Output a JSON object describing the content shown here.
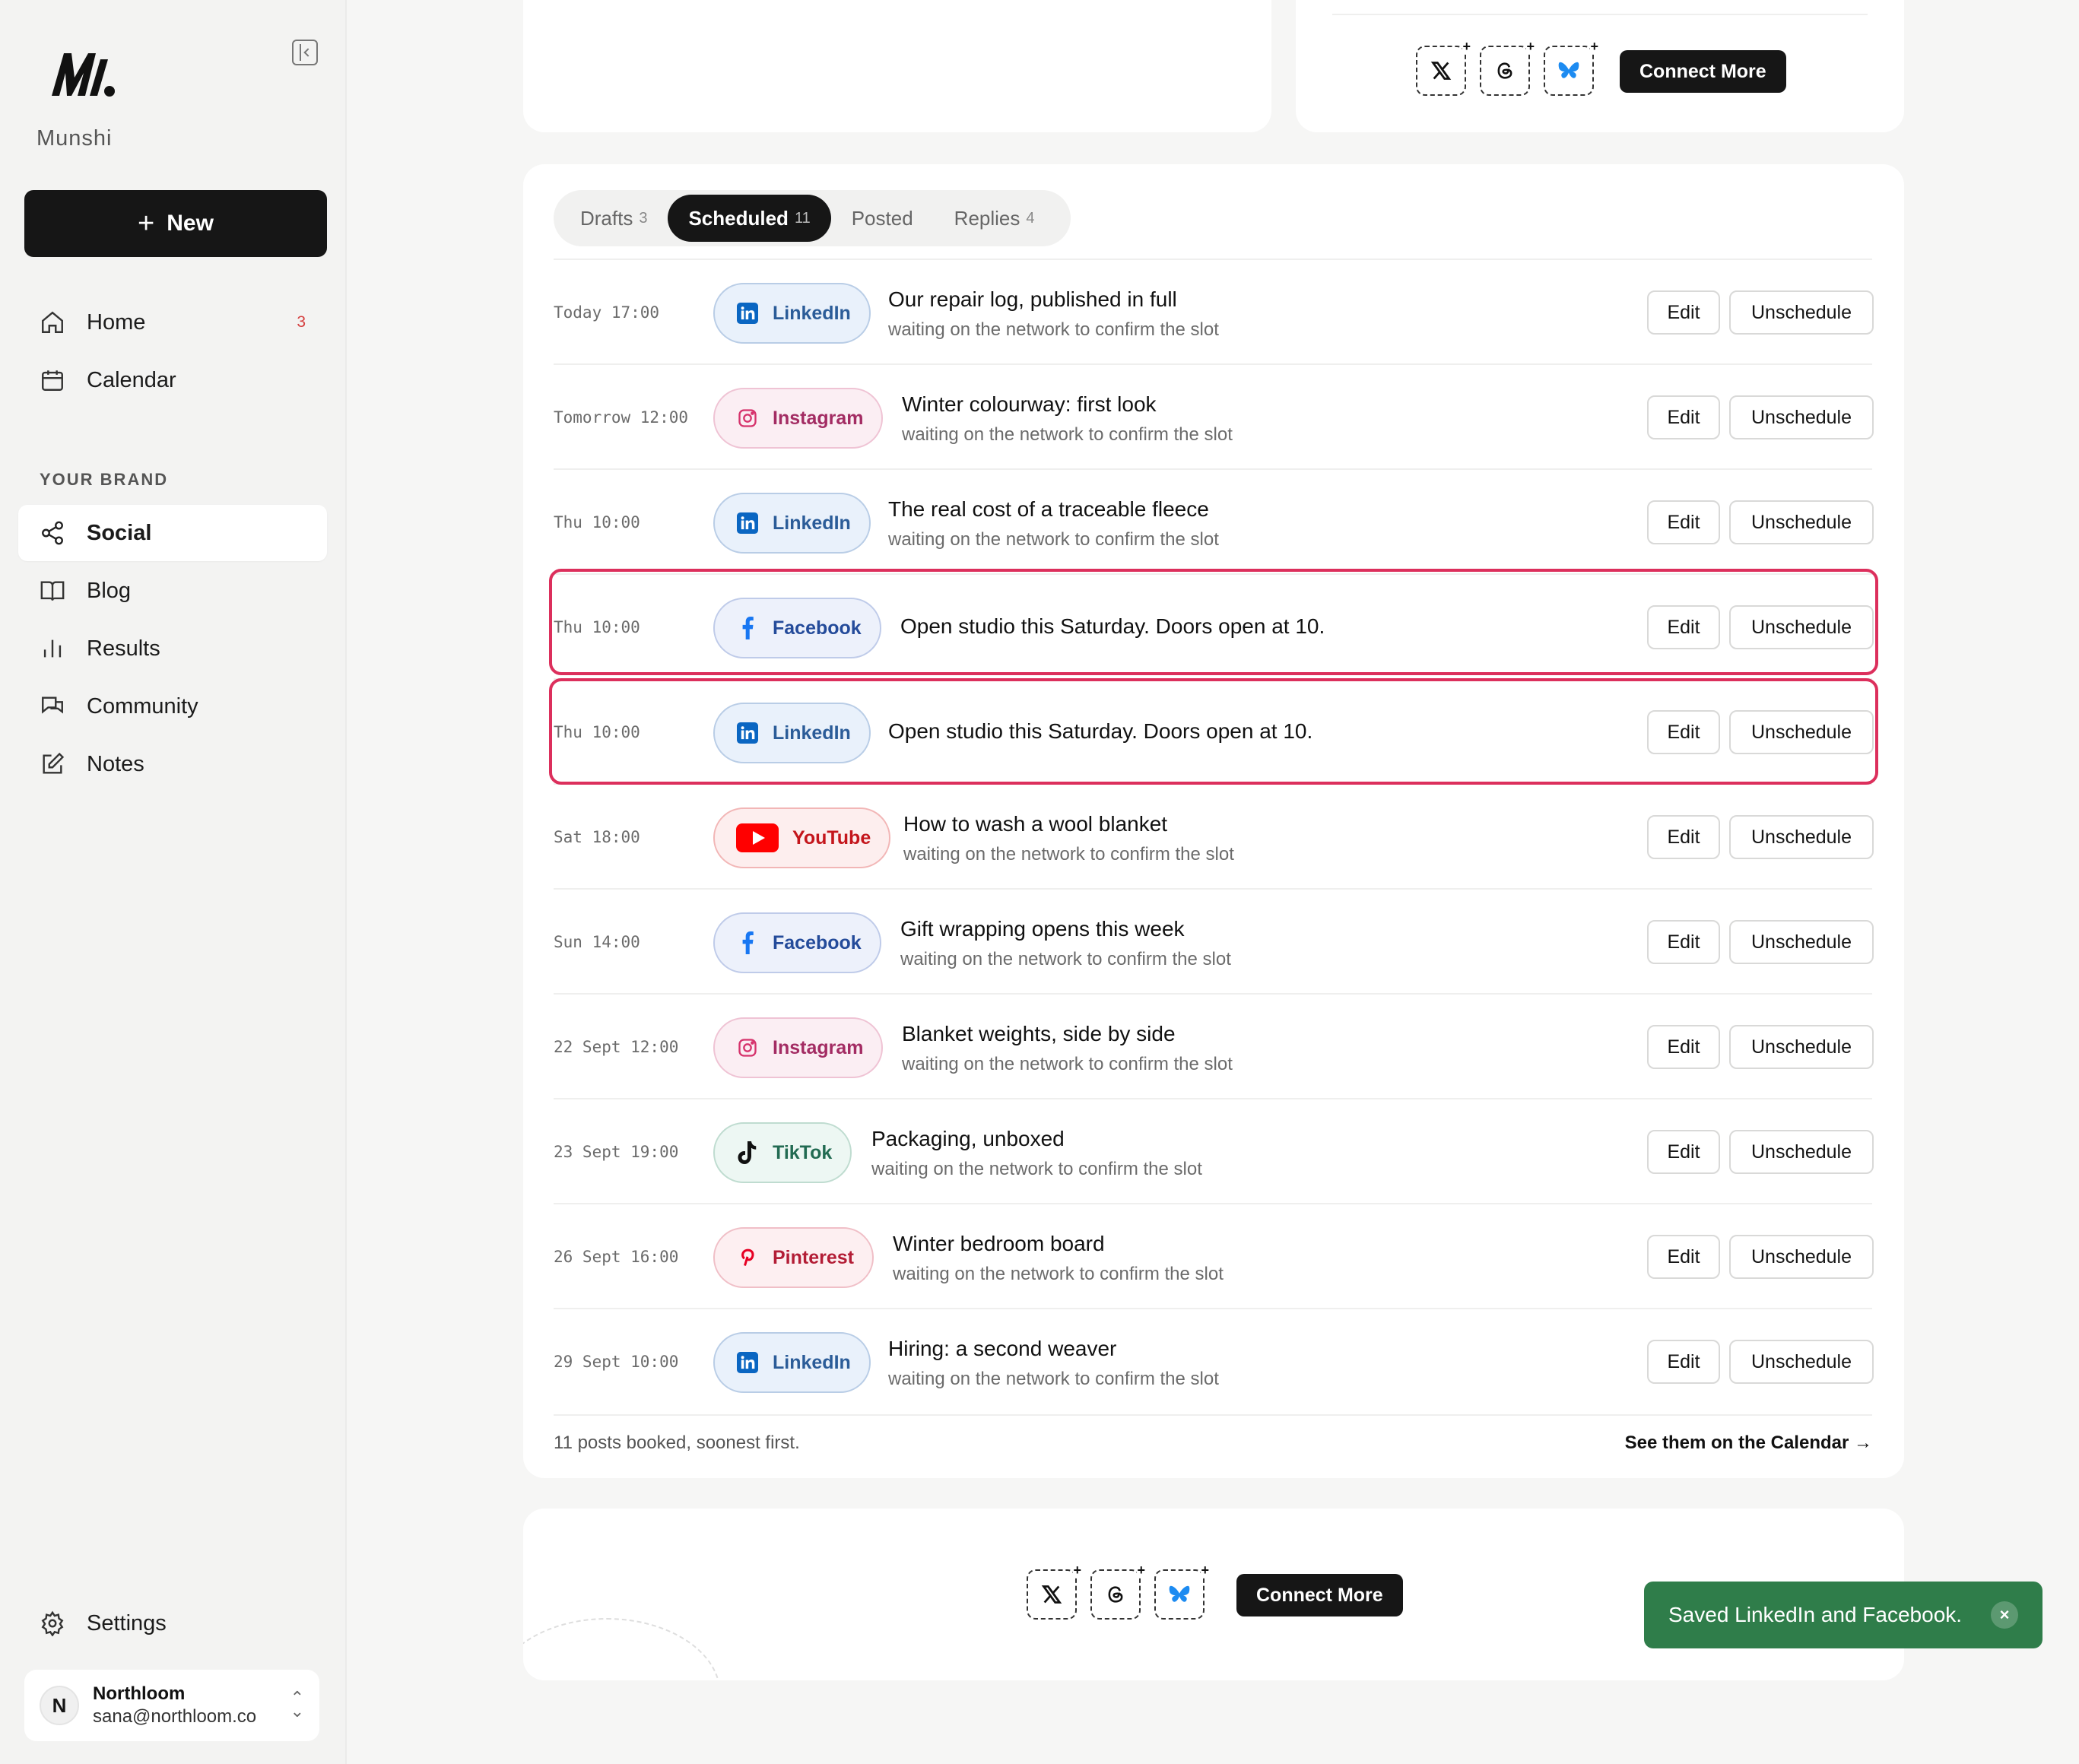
{
  "brand": {
    "name": "Munshi"
  },
  "sidebar": {
    "new_label": "New",
    "nav": [
      {
        "label": "Home",
        "badge": "3",
        "icon": "home-icon"
      },
      {
        "label": "Calendar",
        "icon": "calendar-icon"
      }
    ],
    "section_label": "YOUR BRAND",
    "brand_nav": [
      {
        "label": "Social",
        "icon": "share-icon",
        "active": true
      },
      {
        "label": "Blog",
        "icon": "book-icon"
      },
      {
        "label": "Results",
        "icon": "bar-chart-icon"
      },
      {
        "label": "Community",
        "icon": "chat-icon"
      },
      {
        "label": "Notes",
        "icon": "edit-icon"
      }
    ],
    "settings_label": "Settings",
    "account": {
      "initial": "N",
      "name": "Northloom",
      "email": "sana@northloom.co"
    }
  },
  "connect": {
    "label": "Connect More",
    "networks": [
      "x-icon",
      "threads-icon",
      "bluesky-icon"
    ]
  },
  "tabs": [
    {
      "label": "Drafts",
      "count": "3"
    },
    {
      "label": "Scheduled",
      "count": "11",
      "active": true
    },
    {
      "label": "Posted",
      "count": ""
    },
    {
      "label": "Replies",
      "count": "4"
    }
  ],
  "rows": [
    {
      "time": "Today 17:00",
      "network": "LinkedIn",
      "title": "Our repair log, published in full",
      "sub": "waiting on the network to confirm the slot"
    },
    {
      "time": "Tomorrow 12:00",
      "network": "Instagram",
      "title": "Winter colourway: first look",
      "sub": "waiting on the network to confirm the slot"
    },
    {
      "time": "Thu 10:00",
      "network": "LinkedIn",
      "title": "The real cost of a traceable fleece",
      "sub": "waiting on the network to confirm the slot"
    },
    {
      "time": "Thu 10:00",
      "network": "Facebook",
      "title": "Open studio this Saturday. Doors open at 10.",
      "sub": "",
      "highlighted": true
    },
    {
      "time": "Thu 10:00",
      "network": "LinkedIn",
      "title": "Open studio this Saturday. Doors open at 10.",
      "sub": "",
      "highlighted": true
    },
    {
      "time": "Sat 18:00",
      "network": "YouTube",
      "title": "How to wash a wool blanket",
      "sub": "waiting on the network to confirm the slot"
    },
    {
      "time": "Sun 14:00",
      "network": "Facebook",
      "title": "Gift wrapping opens this week",
      "sub": "waiting on the network to confirm the slot"
    },
    {
      "time": "22 Sept 12:00",
      "network": "Instagram",
      "title": "Blanket weights, side by side",
      "sub": "waiting on the network to confirm the slot"
    },
    {
      "time": "23 Sept 19:00",
      "network": "TikTok",
      "title": "Packaging, unboxed",
      "sub": "waiting on the network to confirm the slot"
    },
    {
      "time": "26 Sept 16:00",
      "network": "Pinterest",
      "title": "Winter bedroom board",
      "sub": "waiting on the network to confirm the slot"
    },
    {
      "time": "29 Sept 10:00",
      "network": "LinkedIn",
      "title": "Hiring: a second weaver",
      "sub": "waiting on the network to confirm the slot"
    }
  ],
  "actions": {
    "edit": "Edit",
    "unschedule": "Unschedule"
  },
  "footer": {
    "note": "11 posts booked, soonest first.",
    "link": "See them on the Calendar →"
  },
  "toast": {
    "message": "Saved LinkedIn and Facebook.",
    "close": "×"
  },
  "colors": {
    "toast": "#2f7d4a",
    "highlight": "#dc2f5c",
    "primary": "#161616"
  }
}
